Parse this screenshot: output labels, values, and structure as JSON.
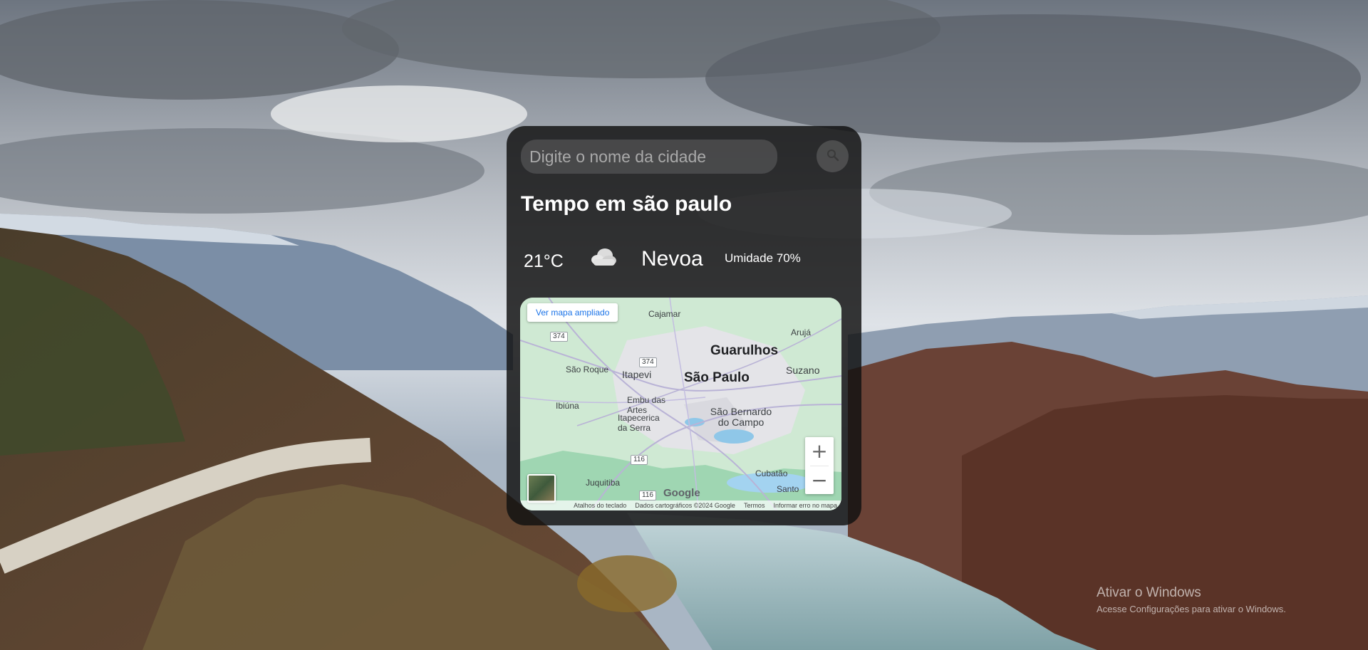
{
  "search": {
    "placeholder": "Digite o nome da cidade",
    "button_icon": "search-icon"
  },
  "weather": {
    "title": "Tempo em são paulo",
    "temperature": "21°C",
    "condition_icon": "cloud-icon",
    "condition": "Nevoa",
    "humidity": "Umidade 70%"
  },
  "map": {
    "view_larger_label": "Ver mapa ampliado",
    "places": {
      "cajamar": "Cajamar",
      "aruja": "Arujá",
      "guarulhos": "Guarulhos",
      "sao_roque": "São Roque",
      "itapevi": "Itapevi",
      "sao_paulo": "São Paulo",
      "suzano": "Suzano",
      "ibiuna": "Ibiúna",
      "embu": "Embu das Artes",
      "itapecerica": "Itapecerica da Serra",
      "sbc": "São Bernardo do Campo",
      "juquitiba": "Juquitiba",
      "cubatao": "Cubatão",
      "santos": "Santo"
    },
    "road_shields": [
      "374",
      "374",
      "116",
      "116"
    ],
    "zoom_in": "+",
    "zoom_out": "−",
    "logo": "Google",
    "attribution": {
      "shortcuts": "Atalhos do teclado",
      "data": "Dados cartográficos ©2024 Google",
      "terms": "Termos",
      "report": "Informar erro no mapa"
    }
  },
  "watermark": {
    "title": "Ativar o Windows",
    "subtitle": "Acesse Configurações para ativar o Windows."
  },
  "colors": {
    "card_bg": "#111111",
    "map_link": "#1a73e8",
    "text": "#ffffff"
  }
}
